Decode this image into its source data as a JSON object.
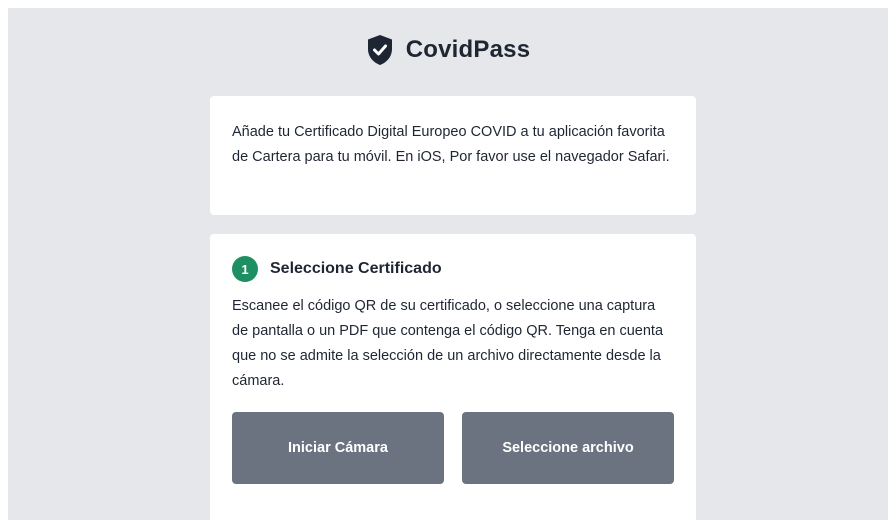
{
  "header": {
    "logo_icon": "shield-check-icon",
    "title": "CovidPass"
  },
  "intro": {
    "text": "Añade tu Certificado Digital Europeo COVID a tu aplicación favorita de Cartera para tu móvil. En iOS, Por favor use el navegador Safari."
  },
  "step": {
    "number": "1",
    "title": "Seleccione Certificado",
    "description": "Escanee el código QR de su certificado, o seleccione una captura de pantalla o un PDF que contenga el código QR. Tenga en cuenta que no se admite la selección de un archivo directamente desde la cámara.",
    "buttons": {
      "start_camera": "Iniciar Cámara",
      "select_file": "Seleccione archivo"
    }
  },
  "colors": {
    "background": "#e6e7ea",
    "card": "#ffffff",
    "text": "#1f2633",
    "accent_green": "#1e8f63",
    "button": "#6b7280"
  }
}
